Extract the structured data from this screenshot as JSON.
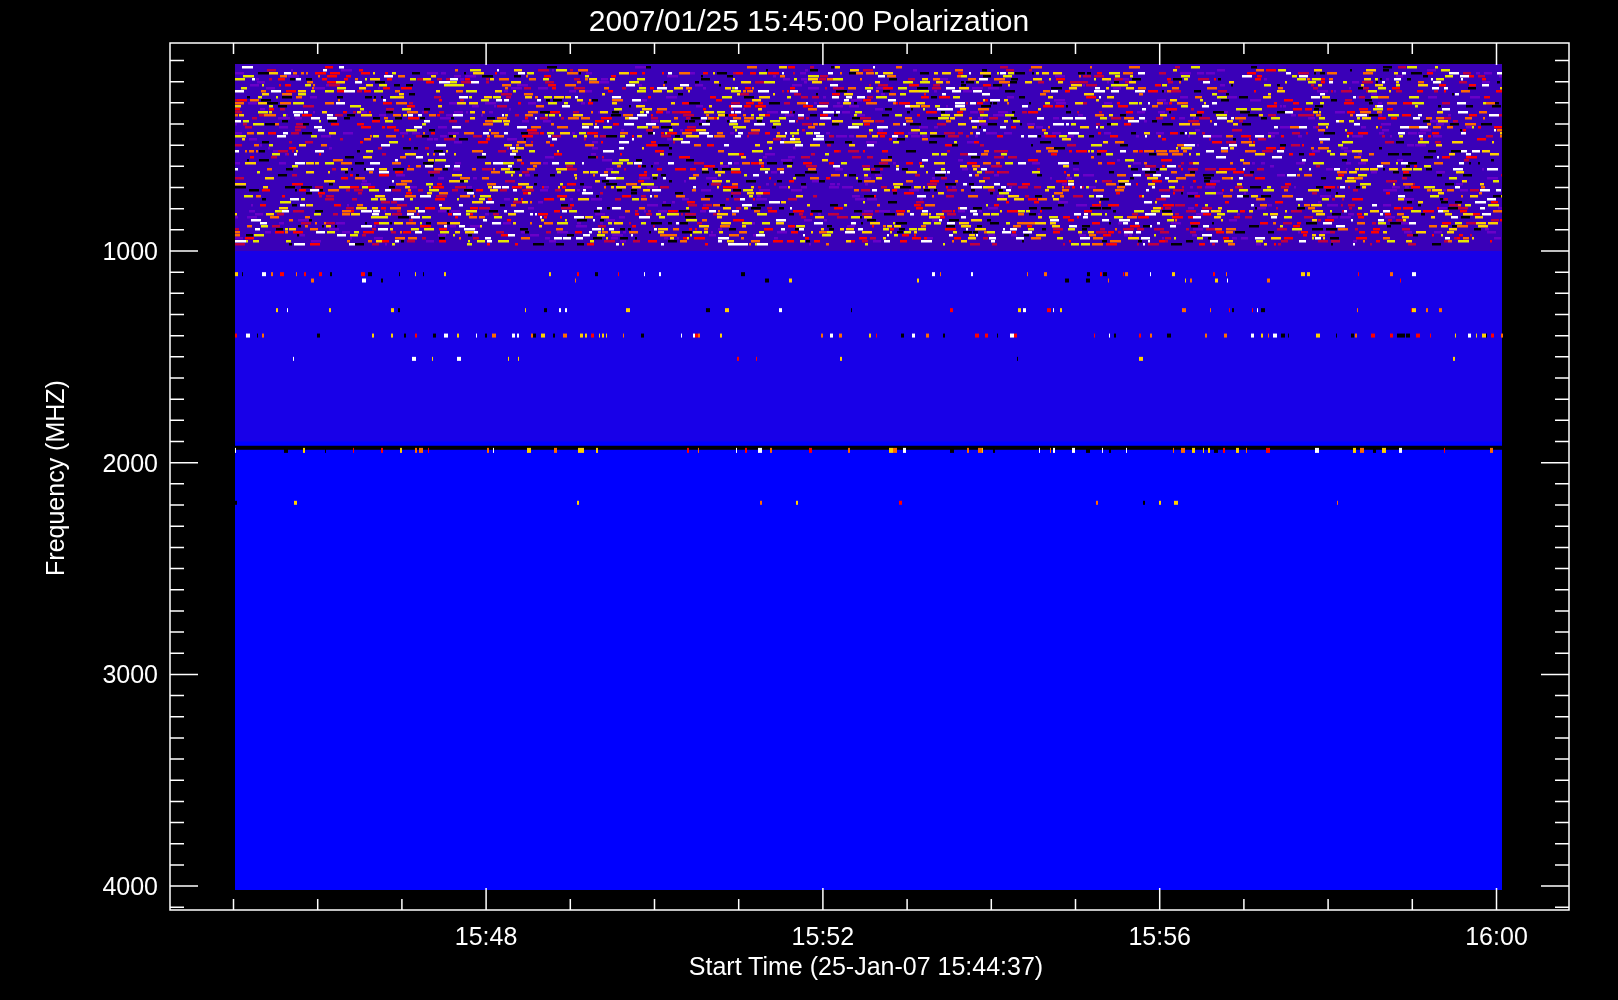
{
  "title": "2007/01/25 15:45:00 Polarization",
  "y_axis": {
    "label": "Frequency (MHZ)",
    "ticks": [
      "1000",
      "2000",
      "3000",
      "4000"
    ]
  },
  "x_axis": {
    "label": "Start Time (25-Jan-07 15:44:37)",
    "ticks": [
      "15:48",
      "15:52",
      "15:56",
      "16:00"
    ]
  }
}
